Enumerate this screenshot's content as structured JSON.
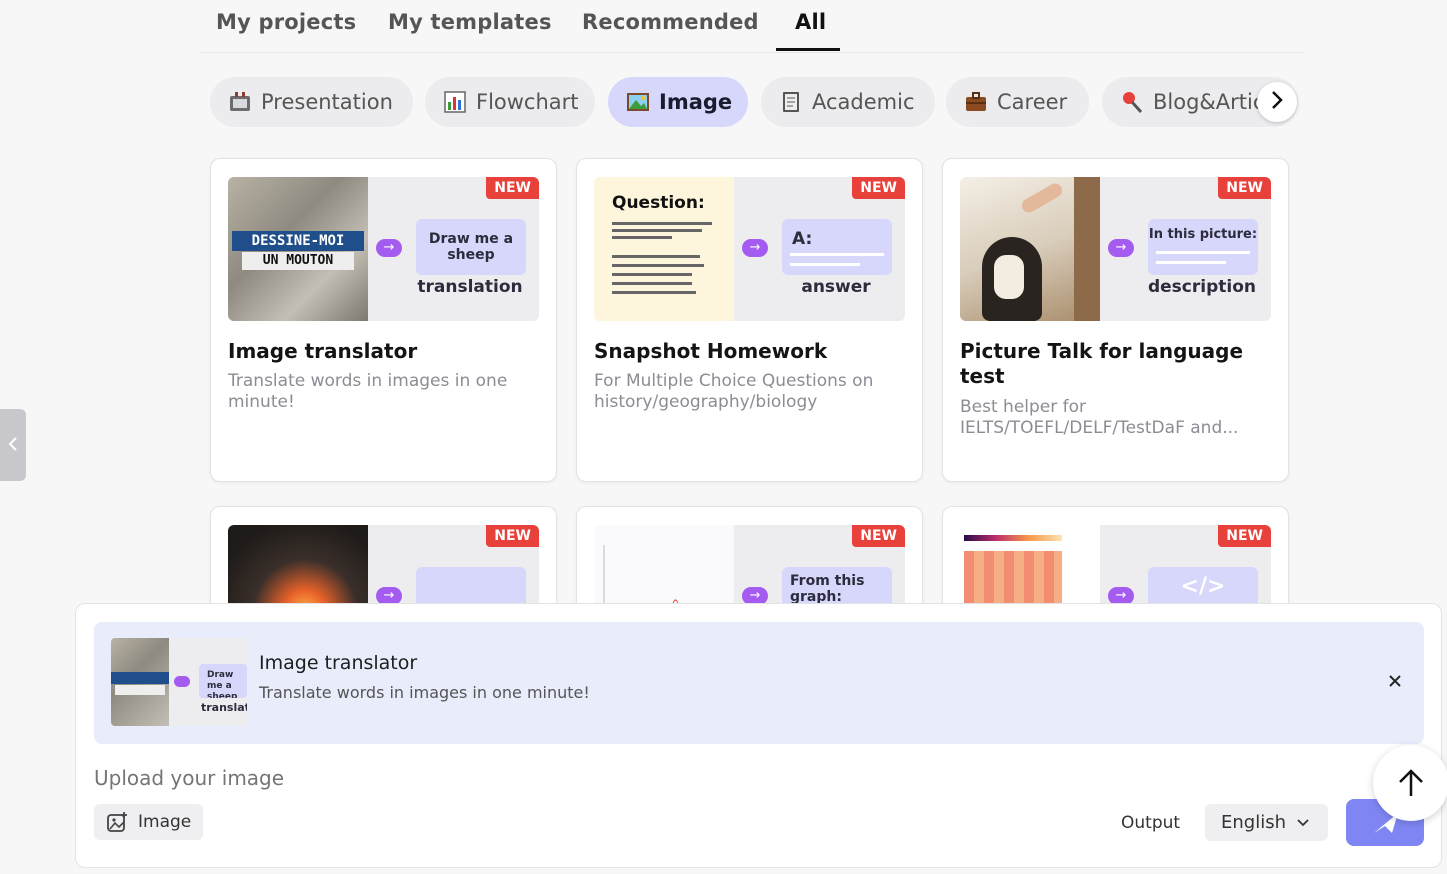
{
  "tabs": [
    {
      "label": "My projects"
    },
    {
      "label": "My templates"
    },
    {
      "label": "Recommended"
    },
    {
      "label": "All"
    }
  ],
  "chips": [
    {
      "label": "Presentation",
      "icon": "presentation-icon"
    },
    {
      "label": "Flowchart",
      "icon": "bar-chart-icon"
    },
    {
      "label": "Image",
      "icon": "picture-icon"
    },
    {
      "label": "Academic",
      "icon": "notebook-icon"
    },
    {
      "label": "Career",
      "icon": "briefcase-icon"
    },
    {
      "label": "Blog&Artic",
      "icon": "pen-icon"
    }
  ],
  "new_badge": "NEW",
  "cards": [
    {
      "title": "Image translator",
      "desc": "Translate words in images in one minute!",
      "thumb_text_1": "DESSINE-MOI",
      "thumb_text_2": "UN MOUTON",
      "bubble": "Draw me a sheep",
      "caption": "translation"
    },
    {
      "title": "Snapshot Homework",
      "desc": "For Multiple Choice Questions on history/geography/biology",
      "question": "Question:",
      "bubble": "A:",
      "caption": "answer"
    },
    {
      "title": "Picture Talk for language test",
      "desc": "Best helper for IELTS/TOEFL/DELF/TestDaF and...",
      "bubble": "In this picture:",
      "caption": "description"
    },
    {
      "title": "",
      "desc": ""
    },
    {
      "title": "",
      "desc": "",
      "bubble": "From this graph:"
    },
    {
      "title": "",
      "desc": "",
      "bubble": "</>"
    }
  ],
  "composer": {
    "selected_title": "Image translator",
    "selected_desc": "Translate words in images in one minute!",
    "selected_bubble": "Draw me a sheep",
    "selected_caption": "translat",
    "placeholder": "Upload your image",
    "image_button": "Image",
    "output_label": "Output",
    "language": "English"
  },
  "colors": {
    "accent": "#7f86f4",
    "chip_active": "#d7d6fb",
    "badge": "#e8413b"
  }
}
